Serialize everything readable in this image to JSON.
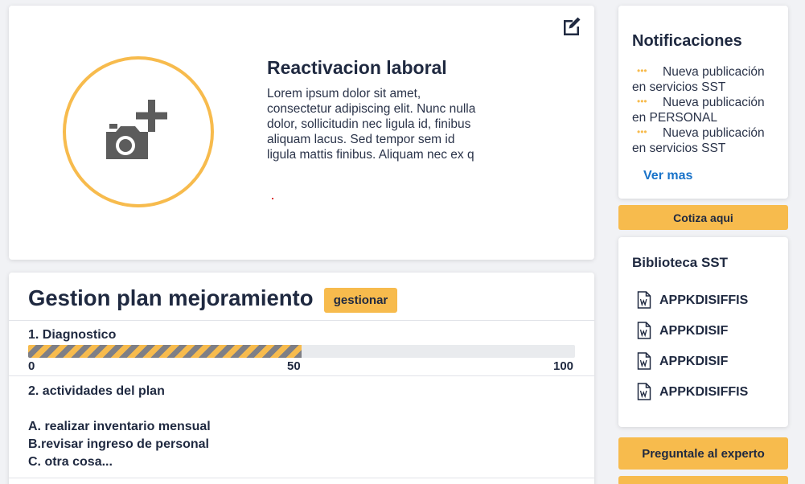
{
  "hero": {
    "title": "Reactivacion laboral",
    "description": "Lorem ipsum dolor sit amet, consectetur adipiscing elit. Nunc nulla dolor, sollicitudin nec ligula id, finibus aliquam lacus. Sed tempor sem id ligula mattis finibus. Aliquam nec ex q",
    "edit_icon": "edit-icon",
    "photo_icon": "add-photo-icon"
  },
  "plan": {
    "title": "Gestion plan mejoramiento",
    "button_label": "gestionar",
    "diagnostic_title": "1. Diagnostico",
    "progress_percent": 50,
    "ticks": [
      "0",
      "50",
      "100"
    ],
    "activities_title": "2. actividades del plan",
    "activities": [
      "A. realizar inventario mensual",
      "B.revisar ingreso de personal",
      "C. otra cosa..."
    ]
  },
  "notifications": {
    "title": "Notificaciones",
    "items": [
      "Nueva publicación en servicios SST",
      "Nueva publicación en PERSONAL",
      "Nueva publicación en servicios SST"
    ],
    "bullet": "•••",
    "more_label": "Ver mas"
  },
  "cotiza_label": "Cotiza aqui",
  "library": {
    "title": "Biblioteca SST",
    "docs": [
      "APPKDISIFFIS",
      "APPKDISIF",
      "APPKDISIF",
      "APPKDISIFFIS"
    ],
    "doc_icon": "word-document-icon"
  },
  "experto_label": "Preguntale al experto",
  "colors": {
    "accent": "#f7bb4d",
    "text": "#1f2940",
    "link": "#1a73c9",
    "background": "#f1f2f5"
  }
}
